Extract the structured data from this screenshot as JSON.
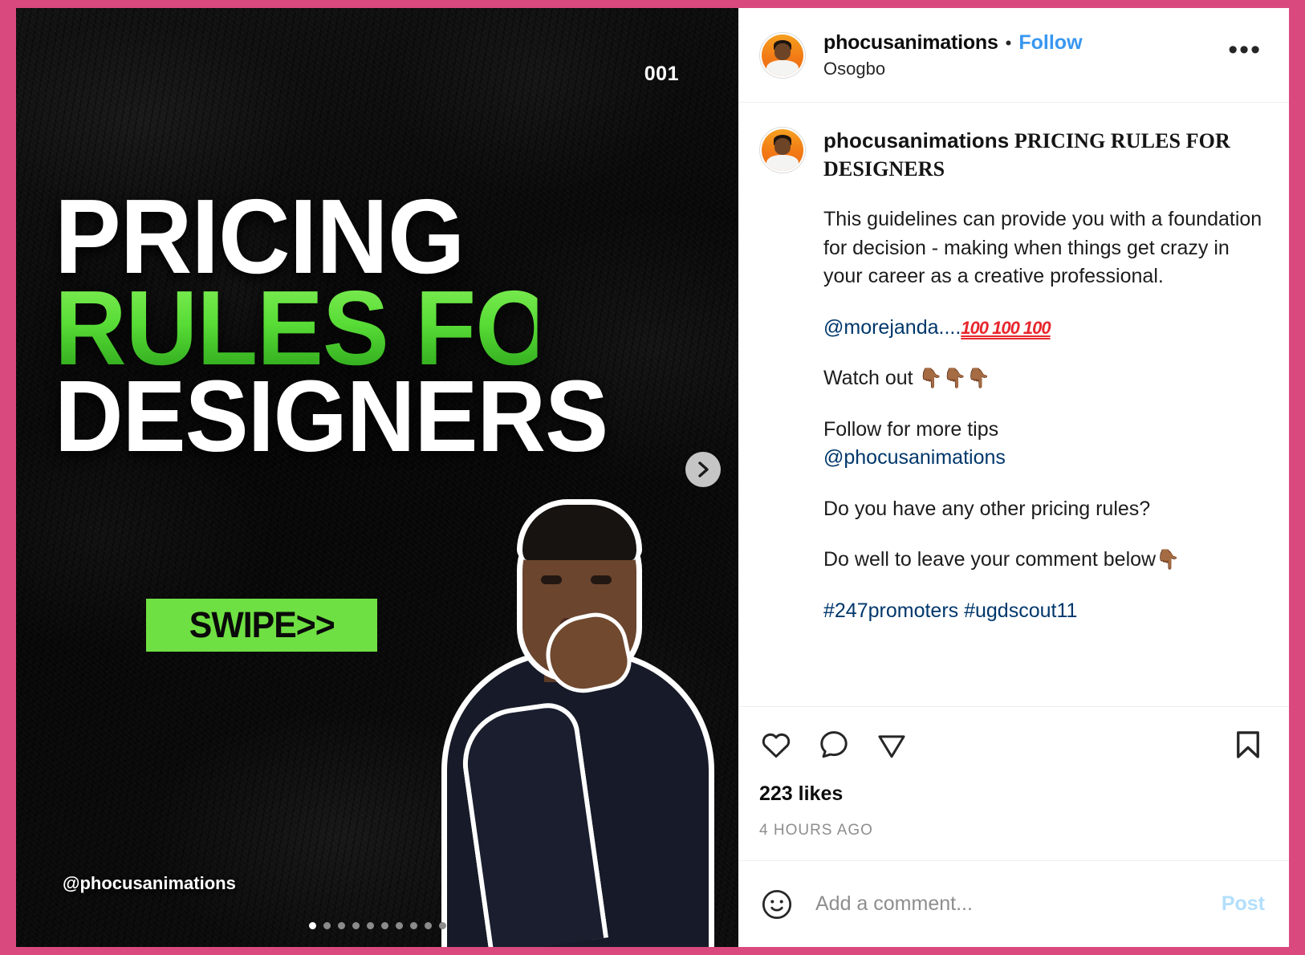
{
  "theme": {
    "border_pink": "#d9497e",
    "link_blue": "#3897f0",
    "mention_blue": "#00376b",
    "muted_gray": "#8e8e8e",
    "post_button_blue": "#b2dffc",
    "badge_green": "#6FE043",
    "headline_green": "#58DC36"
  },
  "media": {
    "slide_number": "001",
    "headline_line_1": "PRICING",
    "headline_line_2": "RULES FOR",
    "headline_line_3": "DESIGNERS",
    "swipe_badge": "SWIPE>>",
    "watermark_handle": "@phocusanimations",
    "next_arrow_icon": "chevron-right-icon",
    "carousel_total_dots": 10,
    "carousel_active_index": 0
  },
  "header": {
    "username": "phocusanimations",
    "separator": "•",
    "follow_label": "Follow",
    "location": "Osogbo",
    "more_options_label": "•••",
    "avatar_icon": "user-avatar"
  },
  "caption": {
    "username": "phocusanimations",
    "title": "PRICING RULES FOR DESIGNERS",
    "paragraphs": [
      "This guidelines can provide you with a foundation for decision - making when things get crazy in your career as a creative professional.",
      "@morejanda....",
      "Watch out",
      "Follow for more tips",
      "@phocusanimations",
      "Do you have any other pricing rules?",
      "Do well to leave your comment below",
      "#247promoters #ugdscout11"
    ],
    "mention_1": "@morejanda....",
    "emoji_hundred": "100 100 100",
    "watch_out": "Watch out",
    "emoji_point_down": "👇🏾👇🏾👇🏾",
    "follow_tips": "Follow for more tips",
    "mention_2": "@phocusanimations",
    "question": "Do you have any other pricing rules?",
    "comment_prompt": "Do well to leave your comment below",
    "emoji_point_down_single": "👇🏾",
    "hashtags": "#247promoters #ugdscout11"
  },
  "actions": {
    "like_icon": "heart-icon",
    "comment_icon": "comment-bubble-icon",
    "share_icon": "share-paper-plane-icon",
    "save_icon": "bookmark-icon",
    "like_count": "223 likes",
    "timestamp": "4 HOURS AGO"
  },
  "comment_bar": {
    "emoji_icon": "smiley-face-icon",
    "placeholder": "Add a comment...",
    "post_label": "Post"
  }
}
